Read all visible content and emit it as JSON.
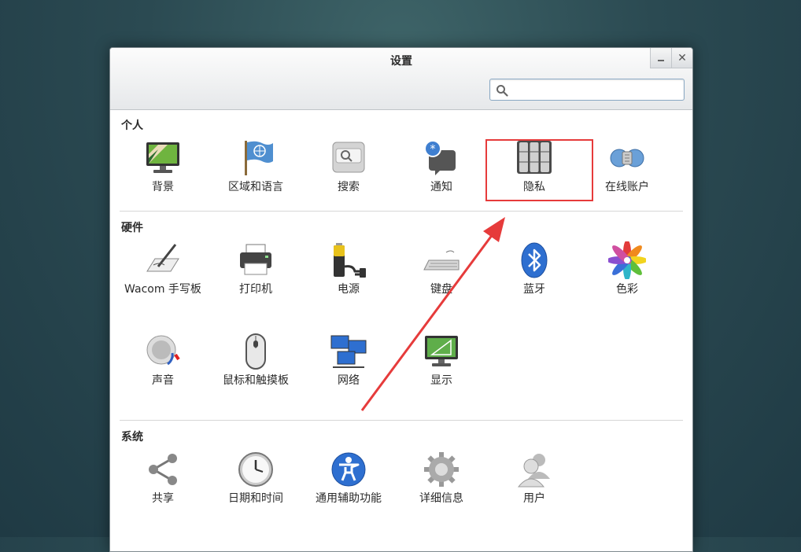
{
  "window": {
    "title": "设置",
    "close_symbol": "✕"
  },
  "search": {
    "placeholder": "",
    "value": ""
  },
  "sections": {
    "personal": {
      "title": "个人",
      "items": [
        "背景",
        "区域和语言",
        "搜索",
        "通知",
        "隐私",
        "在线账户"
      ]
    },
    "hardware": {
      "title": "硬件",
      "items": [
        "Wacom 手写板",
        "打印机",
        "电源",
        "键盘",
        "蓝牙",
        "色彩",
        "声音",
        "鼠标和触摸板",
        "网络",
        "显示"
      ]
    },
    "system": {
      "title": "系统",
      "items": [
        "共享",
        "日期和时间",
        "通用辅助功能",
        "详细信息",
        "用户"
      ]
    }
  },
  "icons": {
    "personal": [
      "background-icon",
      "region-language-icon",
      "search-icon",
      "notifications-icon",
      "privacy-icon",
      "online-accounts-icon"
    ],
    "hardware": [
      "wacom-tablet-icon",
      "printer-icon",
      "power-icon",
      "keyboard-icon",
      "bluetooth-icon",
      "color-icon",
      "sound-icon",
      "mouse-touchpad-icon",
      "network-icon",
      "display-icon"
    ],
    "system": [
      "sharing-icon",
      "date-time-icon",
      "universal-access-icon",
      "details-icon",
      "users-icon"
    ]
  },
  "annotation": {
    "highlight_color": "#e63b3b",
    "highlighted_item": "隐私"
  }
}
